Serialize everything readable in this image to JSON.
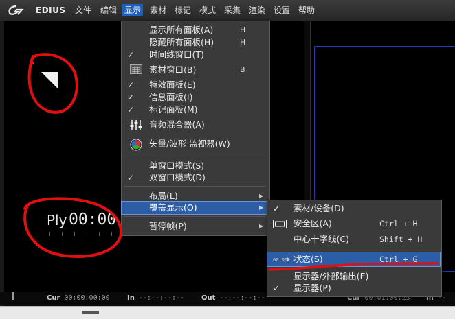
{
  "app": {
    "brand": "EDIUS"
  },
  "menubar": {
    "items": [
      "文件",
      "编辑",
      "显示",
      "素材",
      "标记",
      "模式",
      "采集",
      "渲染",
      "设置",
      "帮助"
    ],
    "active_index": 2
  },
  "display_menu": {
    "items": [
      {
        "label": "显示所有面板(A)",
        "shortcut": "H",
        "checked": false
      },
      {
        "label": "隐藏所有面板(H)",
        "shortcut": "H",
        "checked": false
      },
      {
        "label": "时间线窗口(T)",
        "shortcut": "",
        "checked": true
      },
      {
        "label": "素材窗口(B)",
        "shortcut": "B",
        "checked": false,
        "icon": "bin-window-icon"
      },
      {
        "label": "特效面板(E)",
        "shortcut": "",
        "checked": true
      },
      {
        "label": "信息面板(I)",
        "shortcut": "",
        "checked": true
      },
      {
        "label": "标记面板(M)",
        "shortcut": "",
        "checked": true
      },
      {
        "label": "音频混合器(A)",
        "shortcut": "",
        "checked": false,
        "icon": "audio-mixer-icon"
      },
      {
        "label": "矢量/波形 监视器(W)",
        "shortcut": "",
        "checked": false,
        "icon": "vectorscope-icon"
      },
      {
        "label": "单窗口模式(S)",
        "shortcut": "",
        "checked": false
      },
      {
        "label": "双窗口模式(D)",
        "shortcut": "",
        "checked": true
      },
      {
        "label": "布局(L)",
        "shortcut": "",
        "submenu": true
      },
      {
        "label": "覆盖显示(O)",
        "shortcut": "",
        "submenu": true,
        "highlighted": true
      },
      {
        "label": "暂停帧(P)",
        "shortcut": "",
        "submenu": true
      }
    ]
  },
  "overlay_submenu": {
    "items": [
      {
        "label": "素材/设备(D)",
        "shortcut": "",
        "checked": true
      },
      {
        "label": "安全区(A)",
        "shortcut": "Ctrl + H",
        "icon": "safe-area-icon"
      },
      {
        "label": "中心十字线(C)",
        "shortcut": "Shift + H"
      },
      {
        "label": "状态(S)",
        "shortcut": "Ctrl + G",
        "icon": "status-icon",
        "highlighted": true
      },
      {
        "label": "显示器/外部输出(E)",
        "shortcut": ""
      },
      {
        "label": "显示器(P)",
        "shortcut": "",
        "checked": true
      }
    ]
  },
  "monitor": {
    "play_label": "Ply",
    "timecode": "00:00",
    "cur_label": "Cur",
    "cur_value": "00:00:00:00",
    "in_label": "In",
    "in_value": "--:--:--:--",
    "out_label": "Out",
    "out_value": "--:--:--:--",
    "right_cur_label": "Cur",
    "right_cur_value": "00:01:00:23",
    "right_in_label": "In",
    "right_in_value": "--"
  },
  "colors": {
    "menu_highlight": "#2c5ea8",
    "annotation": "#e01010",
    "safe_frame": "#2a35c9"
  }
}
